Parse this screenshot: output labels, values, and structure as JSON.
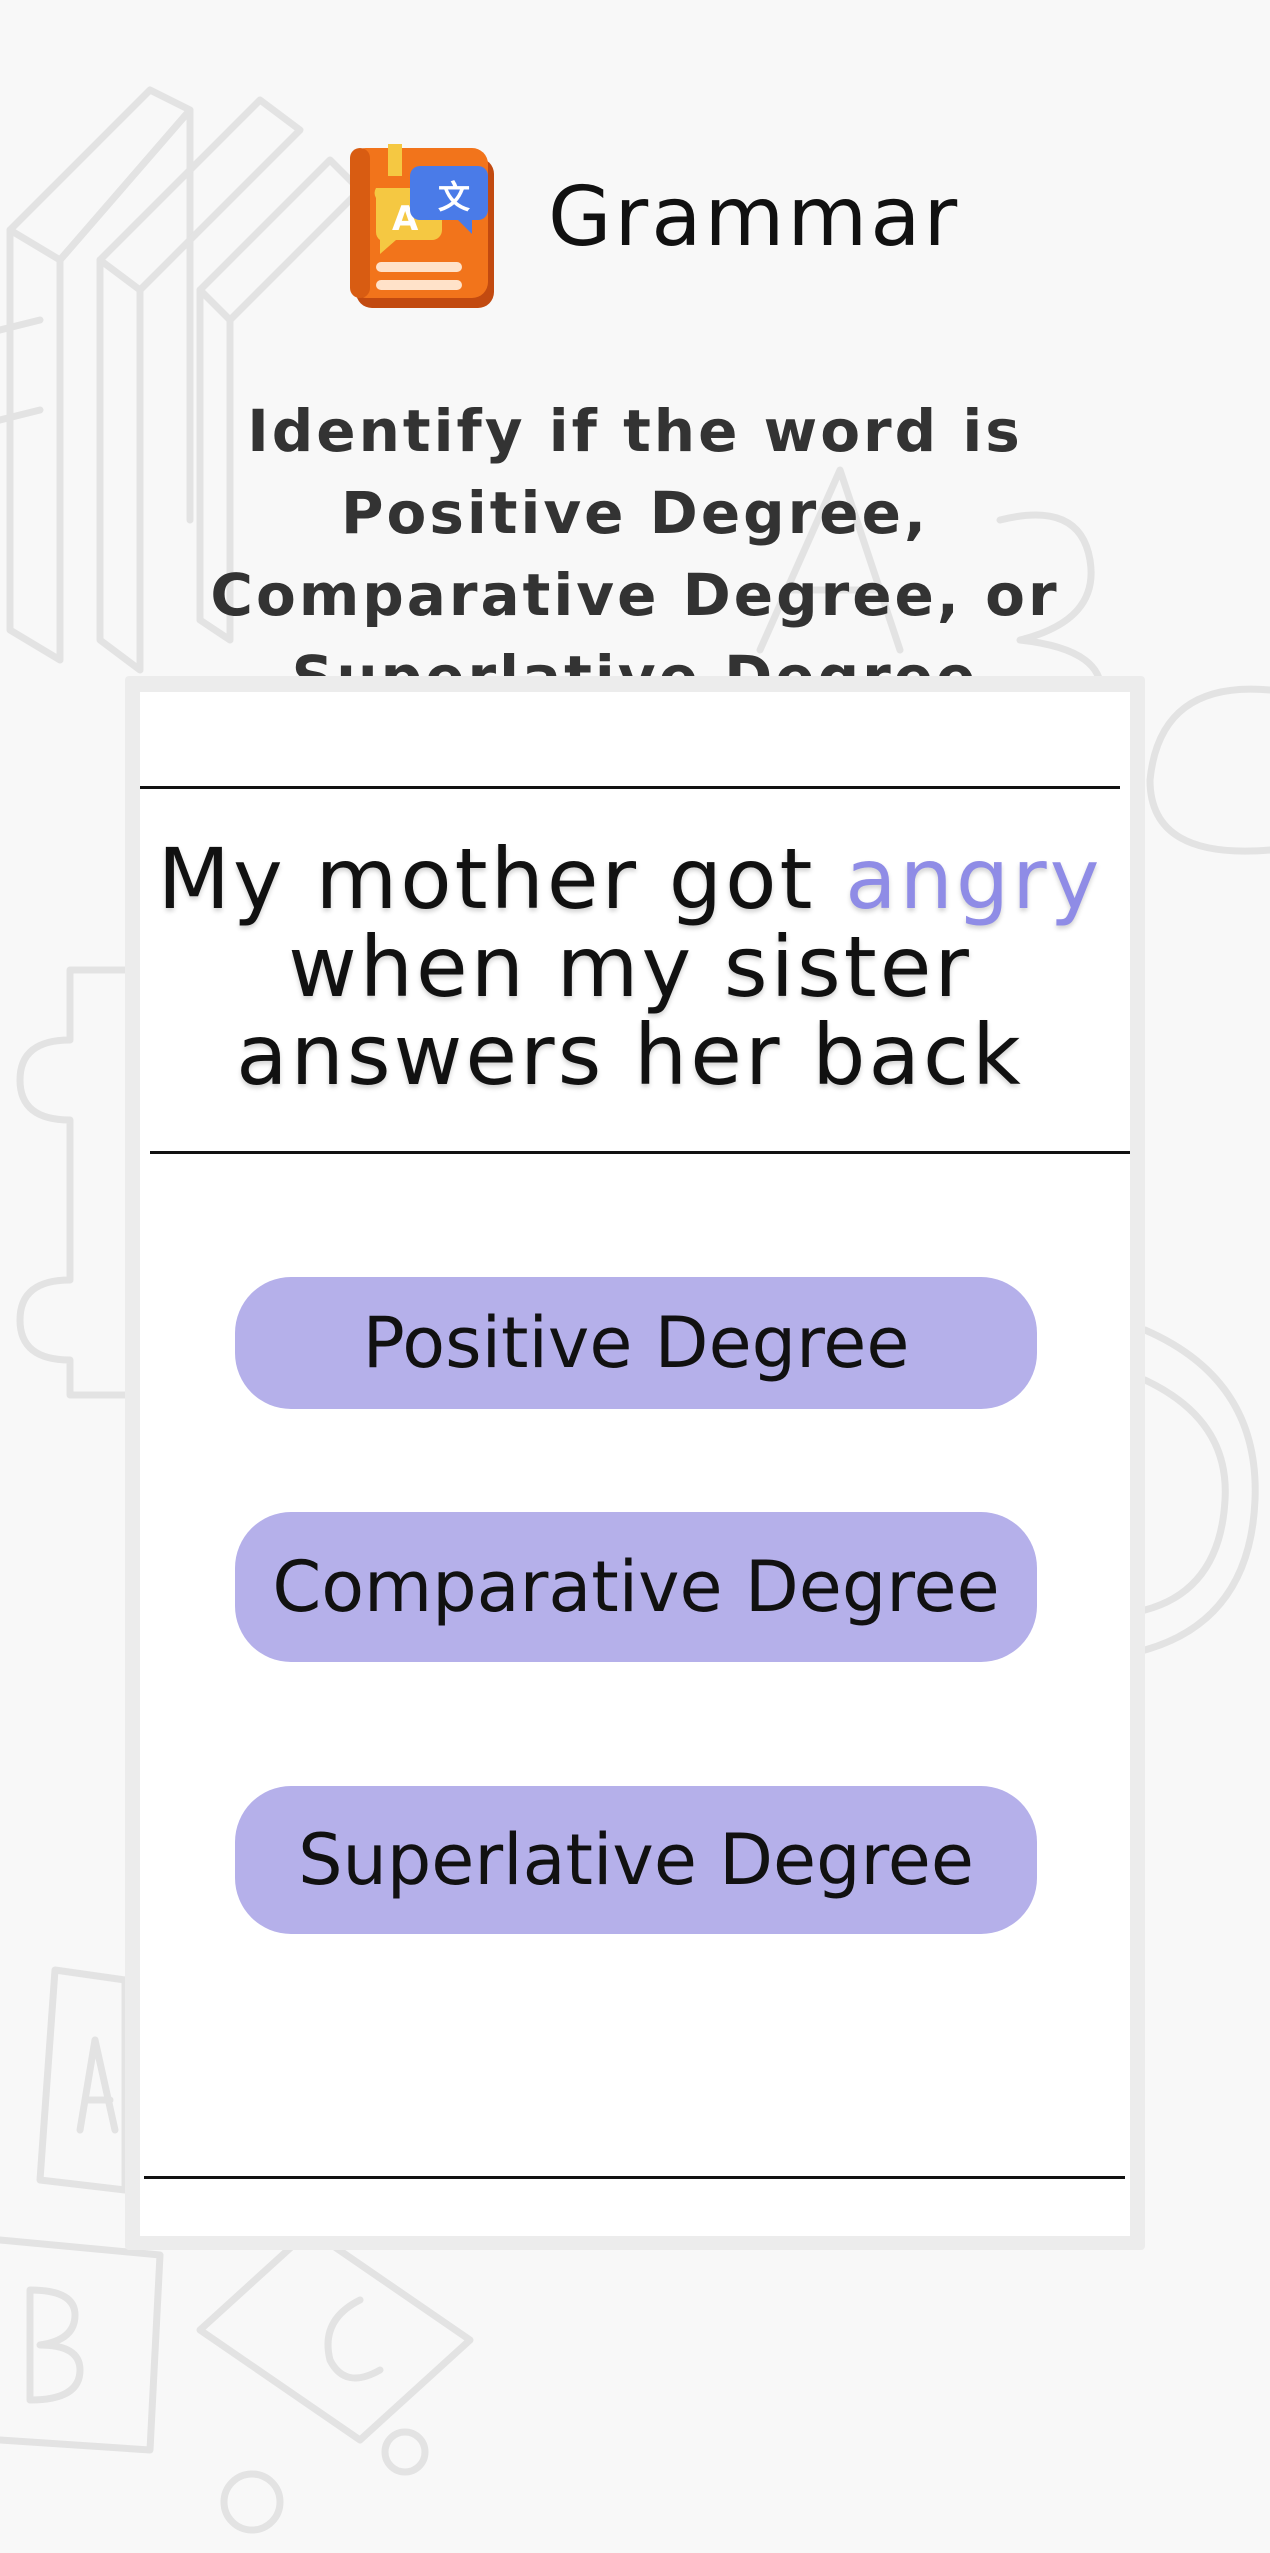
{
  "header": {
    "title": "Grammar",
    "icon": "grammar-book-icon",
    "icon_colors": {
      "book": "#f2741b",
      "bubble": "#4a7be8",
      "label": "#f5c842"
    }
  },
  "instructions": "Identify if the word is Positive Degree, Comparative Degree, or Superlative Degree",
  "question": {
    "before": "My mother got ",
    "highlight": "angry",
    "after": " when my sister answers her back",
    "highlight_color": "#8f8ce6"
  },
  "options": [
    {
      "label": "Positive Degree"
    },
    {
      "label": "Comparative Degree"
    },
    {
      "label": "Superlative Degree"
    }
  ],
  "theme": {
    "background": "#f8f8f8",
    "card": "#ffffff",
    "option_fill": "#b5b0ea"
  }
}
